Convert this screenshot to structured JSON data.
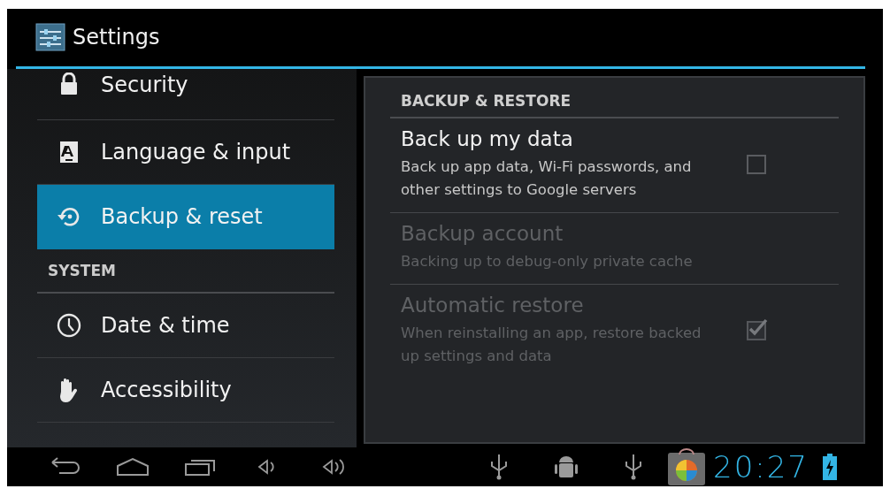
{
  "action_bar": {
    "title": "Settings"
  },
  "sidebar": {
    "items": [
      {
        "kind": "item",
        "label": "Security",
        "selected": false
      },
      {
        "kind": "item",
        "label": "Language & input",
        "selected": false
      },
      {
        "kind": "item",
        "label": "Backup & reset",
        "selected": true
      },
      {
        "kind": "header",
        "label": "SYSTEM"
      },
      {
        "kind": "item",
        "label": "Date & time",
        "selected": false
      },
      {
        "kind": "item",
        "label": "Accessibility",
        "selected": false
      }
    ]
  },
  "panel": {
    "header": "BACKUP & RESTORE",
    "prefs": [
      {
        "kind": "checkbox",
        "title": "Back up my data",
        "summary": "Back up app data, Wi-Fi passwords, and other settings to Google servers",
        "disabled": false,
        "checked": false
      },
      {
        "kind": "text",
        "title": "Backup account",
        "summary": "Backing up to debug-only private cache",
        "disabled": true
      },
      {
        "kind": "checkbox",
        "title": "Automatic restore",
        "summary": "When reinstalling an app, restore backed up settings and data",
        "disabled": true,
        "checked": true
      }
    ]
  },
  "nav_bar": {
    "clock": "20:27"
  }
}
